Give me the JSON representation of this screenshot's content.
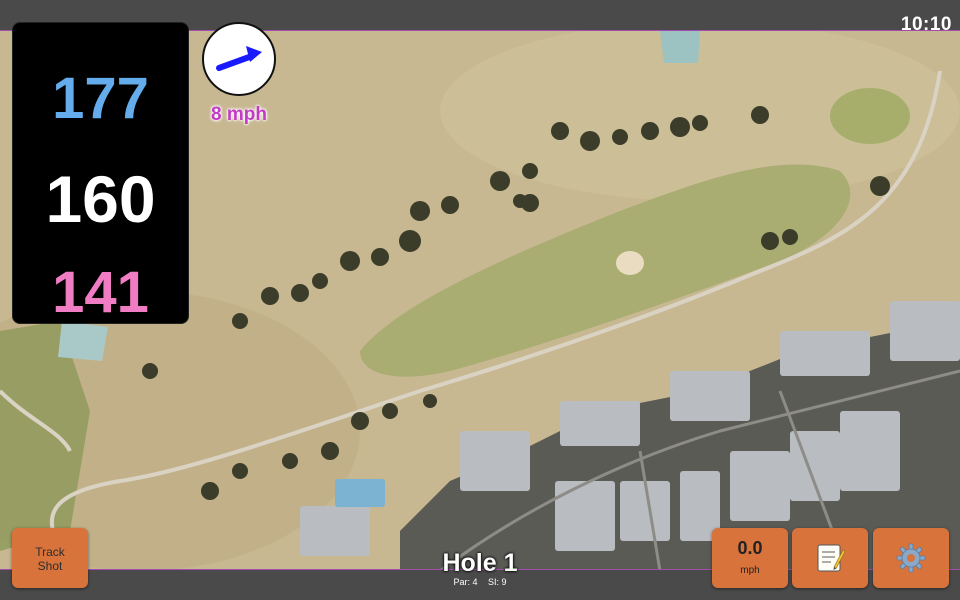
{
  "status_bar": {
    "time": "10:10"
  },
  "yardages": {
    "back": "177",
    "middle": "160",
    "front": "141"
  },
  "wind": {
    "speed_label": "8 mph",
    "direction_icon": "arrow-right-icon",
    "arrow_color": "#1a1aff"
  },
  "hole": {
    "title": "Hole 1",
    "par_label": "Par: 4",
    "stroke_index_label": "SI: 9"
  },
  "buttons": {
    "track_shot_line1": "Track",
    "track_shot_line2": "Shot",
    "speed_value": "0.0",
    "speed_unit": "mph",
    "notes_icon": "notepad-icon",
    "settings_icon": "gear-icon"
  },
  "colors": {
    "back_yardage": "#64acec",
    "middle_yardage": "#ffffff",
    "front_yardage": "#f07cc4",
    "button_bg": "#d8733b",
    "wind_text": "#c23ac6"
  }
}
